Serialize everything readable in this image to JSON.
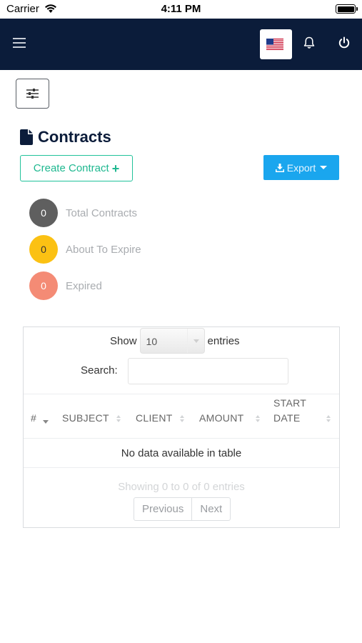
{
  "status_bar": {
    "carrier": "Carrier",
    "time": "4:11 PM"
  },
  "navbar": {
    "menu_icon": "hamburger-icon",
    "language_flag": "us-flag",
    "bell_icon": "bell-icon",
    "power_icon": "power-icon"
  },
  "filter": {
    "icon": "sliders-icon"
  },
  "page": {
    "title": "Contracts",
    "title_icon": "file-icon"
  },
  "actions": {
    "create_label": "Create Contract",
    "create_icon": "+",
    "export_label": "Export"
  },
  "stats": [
    {
      "count": "0",
      "label": "Total Contracts",
      "color": "#5f5f5f",
      "text_color": "#ffffff"
    },
    {
      "count": "0",
      "label": "About To Expire",
      "color": "#fbc113",
      "text_color": "#333333"
    },
    {
      "count": "0",
      "label": "Expired",
      "color": "#f48b75",
      "text_color": "#ffffff"
    }
  ],
  "table": {
    "show_label": "Show",
    "entries_value": "10",
    "entries_label": "entries",
    "search_label": "Search:",
    "search_value": "",
    "columns": [
      "#",
      "SUBJECT",
      "CLIENT",
      "AMOUNT",
      "START",
      "DATE"
    ],
    "empty_message": "No data available in table",
    "info": "Showing 0 to 0 of 0 entries",
    "previous": "Previous",
    "next": "Next"
  },
  "colors": {
    "navbar": "#0b1c3a",
    "accent_green": "#21c29a",
    "accent_blue": "#1aa6ee"
  }
}
